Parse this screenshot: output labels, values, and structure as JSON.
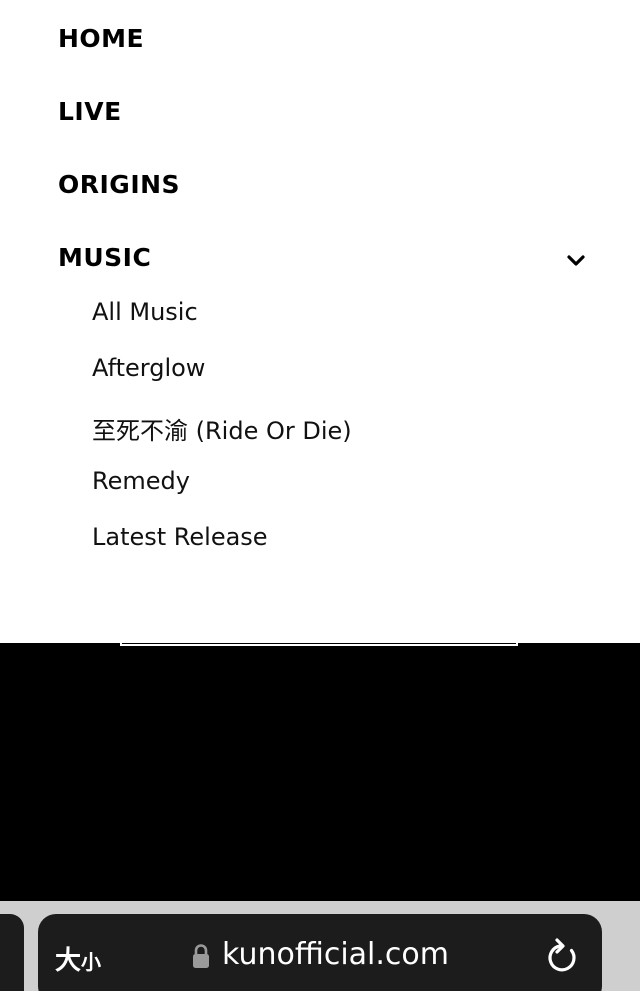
{
  "nav": {
    "items": [
      {
        "label": "HOME"
      },
      {
        "label": "LIVE"
      },
      {
        "label": "ORIGINS"
      },
      {
        "label": "MUSIC",
        "expanded": true
      }
    ],
    "music_submenu": [
      {
        "label": "All Music"
      },
      {
        "label": "Afterglow"
      },
      {
        "label": "至死不渝 (Ride Or Die)"
      },
      {
        "label": "Remedy"
      },
      {
        "label": "Latest Release"
      }
    ]
  },
  "browser": {
    "text_size_big": "大",
    "text_size_small": "小",
    "url": "kunofficial.com",
    "lock_icon": "lock-icon",
    "reload_icon": "reload-icon"
  },
  "colors": {
    "menu_background": "#ffffff",
    "page_background": "#000000",
    "toolbar_pill": "#1c1c1c"
  }
}
